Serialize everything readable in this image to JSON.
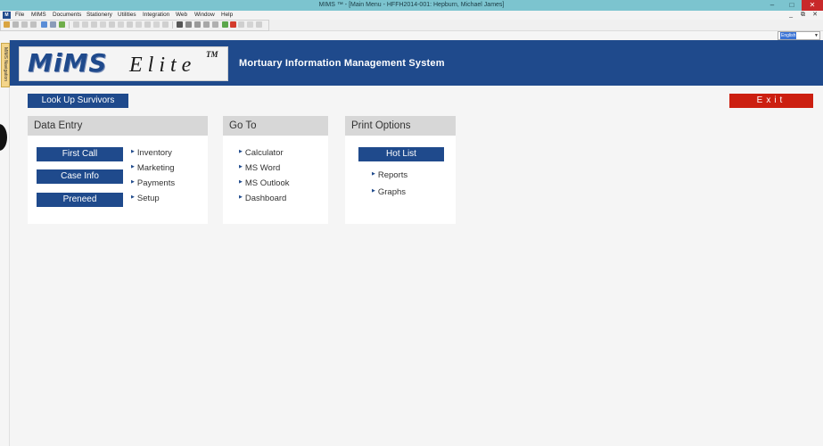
{
  "window": {
    "title": "MIMS ™ - [Main Menu - HFFH2014-001: Hepburn, Michael James]",
    "minimize": "–",
    "maximize": "□",
    "close": "✕"
  },
  "menubar": {
    "items": [
      "File",
      "MIMS",
      "Documents",
      "Stationery",
      "Utilities",
      "Integration",
      "Web",
      "Window",
      "Help"
    ],
    "window_controls": [
      "_",
      "⧉",
      "✕"
    ]
  },
  "language": {
    "selected": "English"
  },
  "left_nav": {
    "tab_label": "MIMS Navigation"
  },
  "header": {
    "logo_main": "MiMS",
    "logo_sub": "Elite",
    "logo_tm": "TM",
    "app_title": "Mortuary Information Management System"
  },
  "actions": {
    "lookup": "Look Up Survivors",
    "exit": "Exit"
  },
  "data_entry": {
    "heading": "Data Entry",
    "buttons": [
      "First Call",
      "Case Info",
      "Preneed"
    ],
    "links": [
      "Inventory",
      "Marketing",
      "Payments",
      "Setup"
    ]
  },
  "go_to": {
    "heading": "Go To",
    "links": [
      "Calculator",
      "MS Word",
      "MS Outlook",
      "Dashboard"
    ]
  },
  "print_options": {
    "heading": "Print Options",
    "button": "Hot List",
    "links": [
      "Reports",
      "Graphs"
    ]
  },
  "colors": {
    "brand_blue": "#1f4a8c",
    "exit_red": "#cc1f10",
    "title_bar": "#7cc4cf",
    "panel_header": "#d7d7d7"
  }
}
